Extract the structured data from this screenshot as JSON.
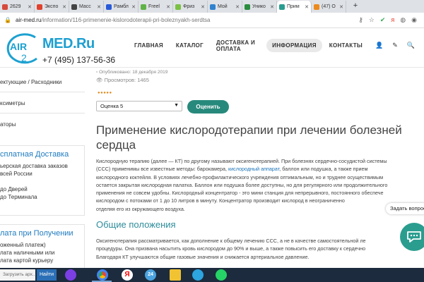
{
  "browser": {
    "tabs": [
      {
        "label": "2629",
        "color": "#d64a3b"
      },
      {
        "label": "Экспо",
        "color": "#e0412e"
      },
      {
        "label": "Масс",
        "color": "#444444"
      },
      {
        "label": "Рамбл",
        "color": "#2a5bd7"
      },
      {
        "label": "Freel",
        "color": "#5fb346"
      },
      {
        "label": "Фриз",
        "color": "#7bc143"
      },
      {
        "label": "Мой",
        "color": "#2f82cf"
      },
      {
        "label": "Унико",
        "color": "#2b8c3f"
      },
      {
        "label": "Прим",
        "color": "#2a9d8f"
      },
      {
        "label": "(47) O",
        "color": "#ec8a1d"
      }
    ],
    "new_tab": "+",
    "url_host": "air-med.ru",
    "url_path": "/information/116-primenenie-kislorodoterapii-pri-boleznyakh-serdtsa"
  },
  "site": {
    "logo_air": "AIR",
    "logo_med": "MED.Ru",
    "phone": "+7 (495) 137-56-36",
    "nav": [
      "ГЛАВНАЯ",
      "КАТАЛОГ",
      "ДОСТАВКА И ОПЛАТА",
      "ИНФОРМАЦИЯ",
      "КОНТАКТЫ"
    ],
    "nav_active": "ИНФОРМАЦИЯ"
  },
  "sidebar": {
    "link1": "ектующие / Расходники",
    "link2": "ксиметры",
    "link3": "аторы",
    "box1_title": "сплатная Доставка",
    "box1_lines": [
      "ьерская доставка заказов",
      "всей России",
      "до Дверей",
      "до Терминала"
    ],
    "box2_title": "лата при Получении",
    "box2_lines": [
      "оженный платеж)",
      "лата наличными или",
      "лата картой курьеру"
    ]
  },
  "article": {
    "published": "Опубликовано: 18 декабря 2019",
    "views": "Просмотров: 1465",
    "rating_select": "Оценка 5",
    "rate_button": "Оценить",
    "title_line1": "Применение кислородотерапии при лечении болезней",
    "title_line2": "сердца",
    "p1_l1": "Кислородную терапию (далее — КТ) по другому называют оксигенотерапией. При болезнях сердечно-сосудистой системы",
    "p1_l2_pre": "(ССС) применимы все известные методы: барокамера, ",
    "p1_link": "кислородный аппарат",
    "p1_l2_post": ", баллон или подушка, а также прием",
    "p1_l3": "кислородного коктейля. В условиях лечебно-профилактического учреждения оптимальным, но и труднее осуществимым",
    "p1_l4": "остается закрытая кислородная палатка. Баллон или подушка более доступны, но для регулярного или продолжительного",
    "p1_l5": "применения не совсем удобны. Кислородный концентратор - это мини станция для непрерывного, постоянного обеспече",
    "p1_l6": "кислородом с потоками от 1 до 10 литров в минуту. Концентратор производит кислород в неограниченно",
    "p1_l7": "отделяя его из окружающего воздуха.",
    "subtitle": "Общие положения",
    "p2_l1": "Оксигенотерапия рассматривается, как дополнение к общему лечению ССС, а не в качестве самостоятельной ле",
    "p2_l2": "процедуры. Она призвана насытить кровь кислородом до 90% и выше, а также повысить его доставку к сердечно",
    "p2_l3": "Благодаря КТ улучшаются общие газовые значения и снижается артериальное давление."
  },
  "widgets": {
    "ask_question": "Задать вопрос"
  },
  "taskbar": {
    "search_placeholder": "Загрузить арх...",
    "find_button": "Найти",
    "badge": "24"
  }
}
